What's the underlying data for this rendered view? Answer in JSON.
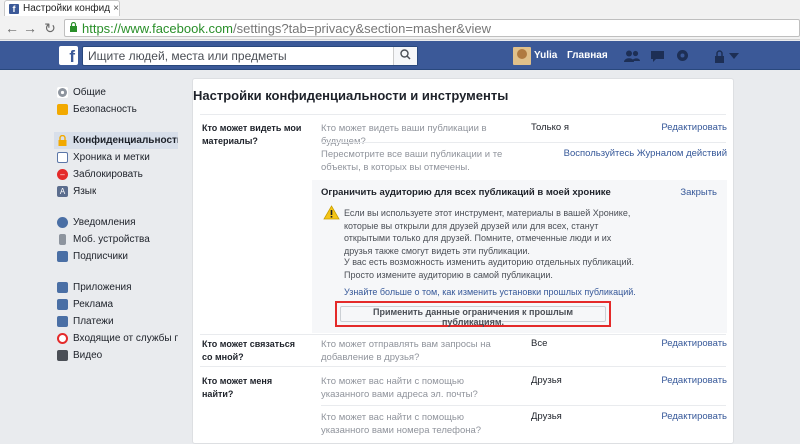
{
  "browser": {
    "tab_title": "Настройки конфиденциа",
    "tab_close": "×",
    "url_host": "https://www.facebook.com",
    "url_path": "/settings?tab=privacy&section=masher&view"
  },
  "fb_header": {
    "search_placeholder": "Ищите людей, места или предметы",
    "user_name": "Yulia",
    "home_label": "Главная"
  },
  "sidebar": {
    "groups": [
      [
        {
          "label": "Общие",
          "icon": "gear-icon",
          "color": "#8d949e"
        },
        {
          "label": "Безопасность",
          "icon": "shield-icon",
          "color": "#f2a900"
        }
      ],
      [
        {
          "label": "Конфиденциальность",
          "icon": "lock-icon",
          "color": "#f2a900",
          "active": true
        },
        {
          "label": "Хроника и метки",
          "icon": "timeline-icon",
          "color": "#5b76a8"
        },
        {
          "label": "Заблокировать",
          "icon": "block-icon",
          "color": "#e42a2a"
        },
        {
          "label": "Язык",
          "icon": "language-icon",
          "color": "#5b6d8e"
        }
      ],
      [
        {
          "label": "Уведомления",
          "icon": "globe-icon",
          "color": "#4a6fa5"
        },
        {
          "label": "Моб. устройства",
          "icon": "mobile-icon",
          "color": "#8d949e"
        },
        {
          "label": "Подписчики",
          "icon": "rss-icon",
          "color": "#4a6fa5"
        }
      ],
      [
        {
          "label": "Приложения",
          "icon": "apps-icon",
          "color": "#4a6fa5"
        },
        {
          "label": "Реклама",
          "icon": "ads-icon",
          "color": "#4a6fa5"
        },
        {
          "label": "Платежи",
          "icon": "payments-icon",
          "color": "#4a6fa5"
        },
        {
          "label": "Входящие от службы по...",
          "icon": "support-icon",
          "color": "#e42a2a"
        },
        {
          "label": "Видео",
          "icon": "video-icon",
          "color": "#4b4f56"
        }
      ]
    ]
  },
  "main": {
    "title": "Настройки конфиденциальности и инструменты",
    "sections": {
      "see": {
        "label": "Кто может видеть мои материалы?",
        "q1": "Кто может видеть ваши публикации в будущем?",
        "v1": "Только я",
        "edit": "Редактировать",
        "q2": "Пересмотрите все ваши публикации и те объекты, в которых вы отмечены.",
        "log_link": "Воспользуйтесь Журналом действий"
      },
      "limit": {
        "title": "Ограничить аудиторию для всех публикаций в моей хронике",
        "close": "Закрыть",
        "text1": "Если вы используете этот инструмент, материалы в вашей Хронике, которые вы открыли для друзей друзей или для всех, станут открытыми только для друзей. Помните, отмеченные люди и их друзья также смогут видеть эти публикации.",
        "text2": "У вас есть возможность изменить аудиторию отдельных публикаций. Просто измените аудиторию в самой публикации.",
        "learn": "Узнайте больше о том, как изменить установки прошлых публикаций.",
        "apply_button": "Применить данные ограничения к прошлым публикациям."
      },
      "contact": {
        "label": "Кто может связаться со мной?",
        "q1": "Кто может отправлять вам запросы на добавление в друзья?",
        "v1": "Все",
        "edit": "Редактировать"
      },
      "find": {
        "label": "Кто может меня найти?",
        "q1": "Кто может вас найти с помощью указанного вами адреса эл. почты?",
        "v1": "Друзья",
        "q2": "Кто может вас найти с помощью указанного вами номера телефона?",
        "v2": "Друзья",
        "edit": "Редактировать"
      }
    }
  }
}
